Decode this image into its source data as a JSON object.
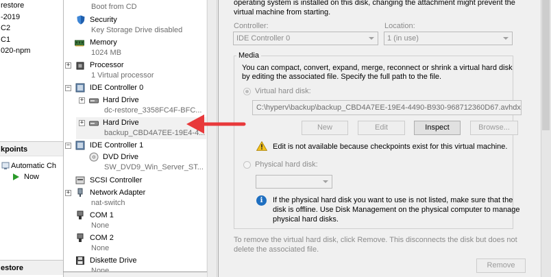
{
  "vm_list": {
    "items": [
      "restore",
      "-2019",
      "C2",
      "C1",
      "020-npm"
    ]
  },
  "checkpoints": {
    "header": "kpoints",
    "items": [
      "Automatic Ch",
      "Now"
    ]
  },
  "restore_header": "estore",
  "hardware": {
    "items": [
      {
        "title": "",
        "sub": "Boot from CD"
      },
      {
        "title": "Security",
        "sub": "Key Storage Drive disabled"
      },
      {
        "title": "Memory",
        "sub": "1024 MB"
      },
      {
        "title": "Processor",
        "sub": "1 Virtual processor"
      },
      {
        "title": "IDE Controller 0",
        "sub": ""
      },
      {
        "title": "Hard Drive",
        "sub": "dc-restore_3358FC4F-BFC..."
      },
      {
        "title": "Hard Drive",
        "sub": "backup_CBD4A7EE-19E4-4..."
      },
      {
        "title": "IDE Controller 1",
        "sub": ""
      },
      {
        "title": "DVD Drive",
        "sub": "SW_DVD9_Win_Server_ST..."
      },
      {
        "title": "SCSI Controller",
        "sub": ""
      },
      {
        "title": "Network Adapter",
        "sub": "nat-switch"
      },
      {
        "title": "COM 1",
        "sub": "None"
      },
      {
        "title": "COM 2",
        "sub": "None"
      },
      {
        "title": "Diskette Drive",
        "sub": "None"
      }
    ]
  },
  "details": {
    "intro_line1": "operating system is installed on this disk, changing the attachment might prevent the",
    "intro_line2": "virtual machine from starting.",
    "controller_label": "Controller:",
    "controller_value": "IDE Controller 0",
    "location_label": "Location:",
    "location_value": "1 (in use)",
    "media_label": "Media",
    "media_desc1": "You can compact, convert, expand, merge, reconnect or shrink a virtual hard disk",
    "media_desc2": "by editing the associated file. Specify the full path to the file.",
    "vhd_label": "Virtual hard disk:",
    "vhd_path": "C:\\hyperv\\backup\\backup_CBD4A7EE-19E4-4490-B930-968712360D67.avhdx",
    "buttons": {
      "new": "New",
      "edit": "Edit",
      "inspect": "Inspect",
      "browse": "Browse..."
    },
    "warning_text": "Edit is not available because checkpoints exist for this virtual machine.",
    "phys_label": "Physical hard disk:",
    "phys_info1": "If the physical hard disk you want to use is not listed, make sure that the",
    "phys_info2": "disk is offline. Use Disk Management on the physical computer to manage",
    "phys_info3": "physical hard disks.",
    "remove_desc1": "To remove the virtual hard disk, click Remove. This disconnects the disk but does not",
    "remove_desc2": "delete the associated file.",
    "remove_label": "Remove"
  },
  "colors": {
    "arrow": "#e8393b",
    "info": "#1f6fc0",
    "warning": "#f2c01d"
  }
}
